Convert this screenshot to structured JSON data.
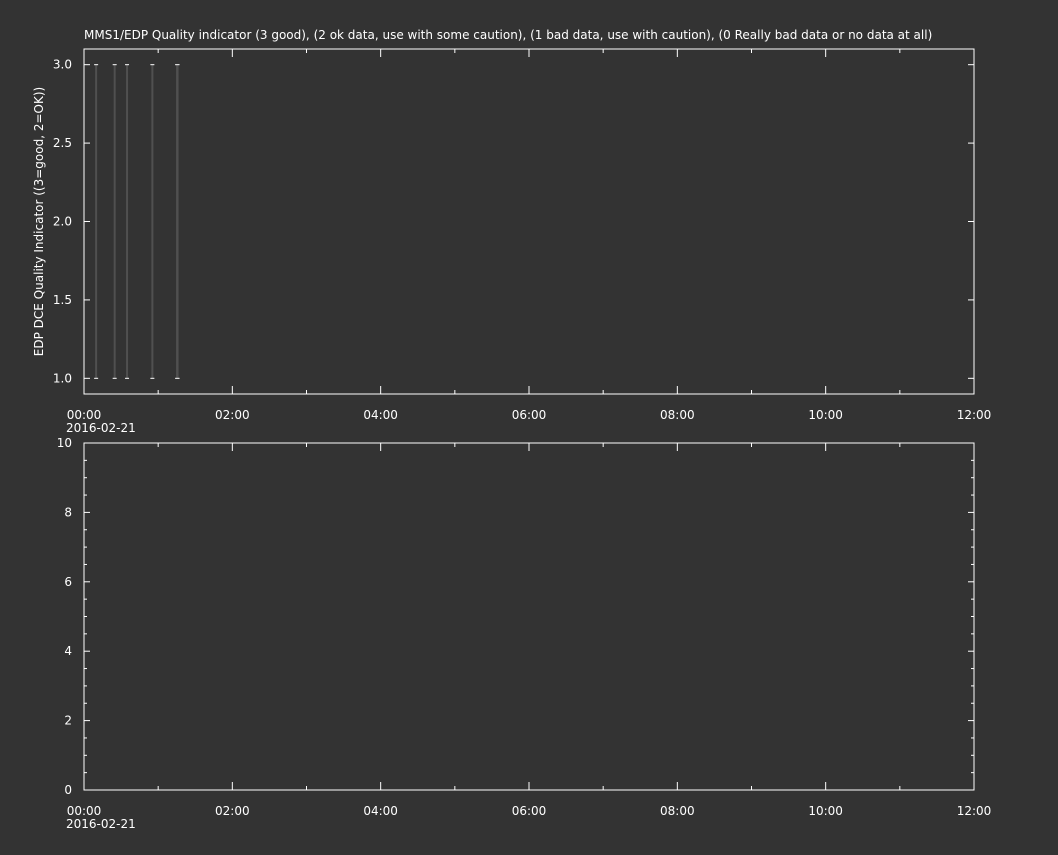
{
  "background_color": "#333333",
  "foreground_color": "#ffffff",
  "chart_data": [
    {
      "type": "line",
      "title": "MMS1/EDP  Quality indicator (3 good), (2 ok data, use with some caution), (1 bad data, use with caution), (0 Really bad data or no data at all)",
      "xlabel": "",
      "ylabel": "EDP DCE Quality Indicator ((3=good, 2=OK))",
      "x_axis": {
        "type": "time",
        "range": [
          "2016-02-21 00:00",
          "2016-02-21 12:00"
        ],
        "tick_labels": [
          "00:00",
          "02:00",
          "04:00",
          "06:00",
          "08:00",
          "10:00",
          "12:00"
        ],
        "date_label": "2016-02-21"
      },
      "ylim": [
        0.9,
        3.1
      ],
      "y_tick_labels": [
        "1.0",
        "1.5",
        "2.0",
        "2.5",
        "3.0"
      ],
      "series_color": "#505050",
      "grid": false,
      "segments": [
        {
          "x_start": "00:09:00",
          "x_end": "00:10:00",
          "y_low": 1.0,
          "y_high": 3.0
        },
        {
          "x_start": "00:24:00",
          "x_end": "00:25:30",
          "y_low": 1.0,
          "y_high": 3.0
        },
        {
          "x_start": "00:34:00",
          "x_end": "00:35:00",
          "y_low": 1.0,
          "y_high": 3.0
        },
        {
          "x_start": "00:54:30",
          "x_end": "00:55:30",
          "y_low": 1.0,
          "y_high": 3.0
        },
        {
          "x_start": "01:14:30",
          "x_end": "01:16:30",
          "y_low": 1.0,
          "y_high": 3.0
        }
      ]
    },
    {
      "type": "line",
      "title": "",
      "xlabel": "",
      "ylabel": "",
      "x_axis": {
        "type": "time",
        "range": [
          "2016-02-21 00:00",
          "2016-02-21 12:00"
        ],
        "tick_labels": [
          "00:00",
          "02:00",
          "04:00",
          "06:00",
          "08:00",
          "10:00",
          "12:00"
        ],
        "date_label": "2016-02-21"
      },
      "ylim": [
        0,
        10
      ],
      "y_tick_labels": [
        "0",
        "2",
        "4",
        "6",
        "8",
        "10"
      ],
      "grid": false,
      "segments": []
    }
  ]
}
